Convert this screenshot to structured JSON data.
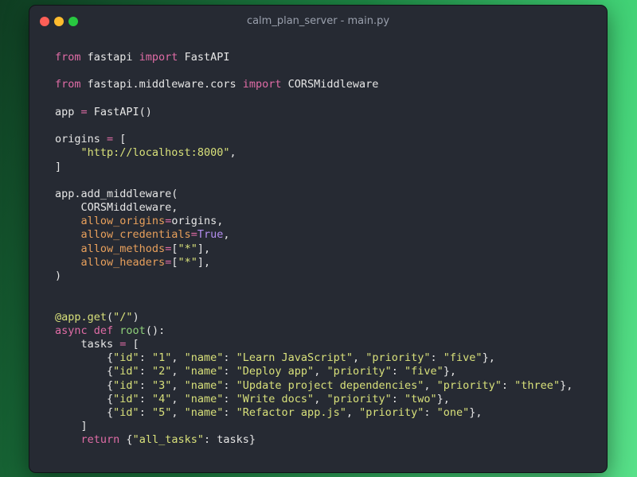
{
  "window": {
    "title": "calm_plan_server - main.py",
    "buttons": [
      "close",
      "minimize",
      "zoom"
    ]
  },
  "theme": {
    "background": "#262a33",
    "keyword": "#e06ca6",
    "string": "#d8e07a",
    "argument": "#e8a05c",
    "constant": "#b48ef0",
    "function": "#8ed07a",
    "text": "#e6e6e6"
  },
  "code": {
    "language": "python",
    "lines": [
      [
        [
          "kw",
          "from"
        ],
        [
          "id",
          " fastapi "
        ],
        [
          "kw",
          "import"
        ],
        [
          "id",
          " FastAPI"
        ]
      ],
      [],
      [
        [
          "kw",
          "from"
        ],
        [
          "id",
          " fastapi.middleware.cors "
        ],
        [
          "kw",
          "import"
        ],
        [
          "id",
          " CORSMiddleware"
        ]
      ],
      [],
      [
        [
          "id",
          "app "
        ],
        [
          "op",
          "="
        ],
        [
          "id",
          " FastAPI()"
        ]
      ],
      [],
      [
        [
          "id",
          "origins "
        ],
        [
          "op",
          "="
        ],
        [
          "pn",
          " ["
        ]
      ],
      [
        [
          "id",
          "    "
        ],
        [
          "str",
          "\"http://localhost:8000\""
        ],
        [
          "pn",
          ","
        ]
      ],
      [
        [
          "pn",
          "]"
        ]
      ],
      [],
      [
        [
          "id",
          "app.add_middleware("
        ]
      ],
      [
        [
          "id",
          "    CORSMiddleware,"
        ]
      ],
      [
        [
          "id",
          "    "
        ],
        [
          "arg",
          "allow_origins"
        ],
        [
          "op",
          "="
        ],
        [
          "id",
          "origins,"
        ]
      ],
      [
        [
          "id",
          "    "
        ],
        [
          "arg",
          "allow_credentials"
        ],
        [
          "op",
          "="
        ],
        [
          "const",
          "True"
        ],
        [
          "pn",
          ","
        ]
      ],
      [
        [
          "id",
          "    "
        ],
        [
          "arg",
          "allow_methods"
        ],
        [
          "op",
          "="
        ],
        [
          "pn",
          "["
        ],
        [
          "str",
          "\"*\""
        ],
        [
          "pn",
          "],"
        ]
      ],
      [
        [
          "id",
          "    "
        ],
        [
          "arg",
          "allow_headers"
        ],
        [
          "op",
          "="
        ],
        [
          "pn",
          "["
        ],
        [
          "str",
          "\"*\""
        ],
        [
          "pn",
          "],"
        ]
      ],
      [
        [
          "pn",
          ")"
        ]
      ],
      [],
      [],
      [
        [
          "dec",
          "@app.get"
        ],
        [
          "pn",
          "("
        ],
        [
          "str",
          "\"/\""
        ],
        [
          "pn",
          ")"
        ]
      ],
      [
        [
          "kw",
          "async def"
        ],
        [
          "id",
          " "
        ],
        [
          "fn",
          "root"
        ],
        [
          "pn",
          "():"
        ]
      ],
      [
        [
          "id",
          "    tasks "
        ],
        [
          "op",
          "="
        ],
        [
          "pn",
          " ["
        ]
      ],
      [
        [
          "id",
          "        "
        ],
        [
          "pn",
          "{"
        ],
        [
          "str",
          "\"id\""
        ],
        [
          "pn",
          ": "
        ],
        [
          "str",
          "\"1\""
        ],
        [
          "pn",
          ", "
        ],
        [
          "str",
          "\"name\""
        ],
        [
          "pn",
          ": "
        ],
        [
          "str",
          "\"Learn JavaScript\""
        ],
        [
          "pn",
          ", "
        ],
        [
          "str",
          "\"priority\""
        ],
        [
          "pn",
          ": "
        ],
        [
          "str",
          "\"five\""
        ],
        [
          "pn",
          "},"
        ]
      ],
      [
        [
          "id",
          "        "
        ],
        [
          "pn",
          "{"
        ],
        [
          "str",
          "\"id\""
        ],
        [
          "pn",
          ": "
        ],
        [
          "str",
          "\"2\""
        ],
        [
          "pn",
          ", "
        ],
        [
          "str",
          "\"name\""
        ],
        [
          "pn",
          ": "
        ],
        [
          "str",
          "\"Deploy app\""
        ],
        [
          "pn",
          ", "
        ],
        [
          "str",
          "\"priority\""
        ],
        [
          "pn",
          ": "
        ],
        [
          "str",
          "\"five\""
        ],
        [
          "pn",
          "},"
        ]
      ],
      [
        [
          "id",
          "        "
        ],
        [
          "pn",
          "{"
        ],
        [
          "str",
          "\"id\""
        ],
        [
          "pn",
          ": "
        ],
        [
          "str",
          "\"3\""
        ],
        [
          "pn",
          ", "
        ],
        [
          "str",
          "\"name\""
        ],
        [
          "pn",
          ": "
        ],
        [
          "str",
          "\"Update project dependencies\""
        ],
        [
          "pn",
          ", "
        ],
        [
          "str",
          "\"priority\""
        ],
        [
          "pn",
          ": "
        ],
        [
          "str",
          "\"three\""
        ],
        [
          "pn",
          "},"
        ]
      ],
      [
        [
          "id",
          "        "
        ],
        [
          "pn",
          "{"
        ],
        [
          "str",
          "\"id\""
        ],
        [
          "pn",
          ": "
        ],
        [
          "str",
          "\"4\""
        ],
        [
          "pn",
          ", "
        ],
        [
          "str",
          "\"name\""
        ],
        [
          "pn",
          ": "
        ],
        [
          "str",
          "\"Write docs\""
        ],
        [
          "pn",
          ", "
        ],
        [
          "str",
          "\"priority\""
        ],
        [
          "pn",
          ": "
        ],
        [
          "str",
          "\"two\""
        ],
        [
          "pn",
          "},"
        ]
      ],
      [
        [
          "id",
          "        "
        ],
        [
          "pn",
          "{"
        ],
        [
          "str",
          "\"id\""
        ],
        [
          "pn",
          ": "
        ],
        [
          "str",
          "\"5\""
        ],
        [
          "pn",
          ", "
        ],
        [
          "str",
          "\"name\""
        ],
        [
          "pn",
          ": "
        ],
        [
          "str",
          "\"Refactor app.js\""
        ],
        [
          "pn",
          ", "
        ],
        [
          "str",
          "\"priority\""
        ],
        [
          "pn",
          ": "
        ],
        [
          "str",
          "\"one\""
        ],
        [
          "pn",
          "},"
        ]
      ],
      [
        [
          "id",
          "    "
        ],
        [
          "pn",
          "]"
        ]
      ],
      [
        [
          "id",
          "    "
        ],
        [
          "kw",
          "return"
        ],
        [
          "pn",
          " {"
        ],
        [
          "str",
          "\"all_tasks\""
        ],
        [
          "pn",
          ": "
        ],
        [
          "id",
          "tasks"
        ],
        [
          "pn",
          "}"
        ]
      ]
    ]
  }
}
